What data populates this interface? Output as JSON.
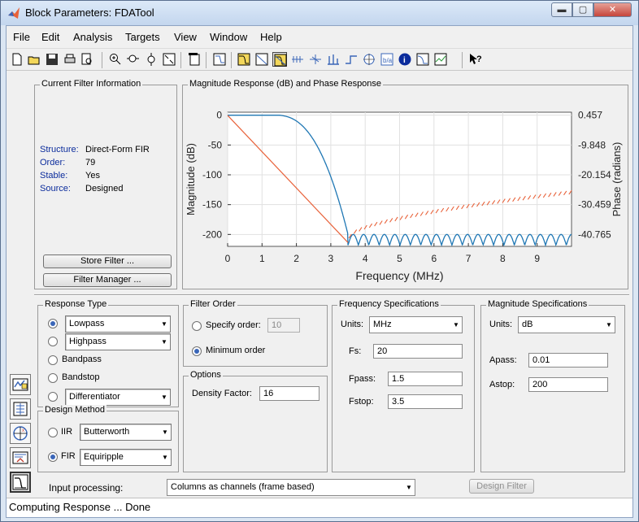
{
  "window": {
    "title": "Block Parameters: FDATool",
    "controls": {
      "minimize": "▬",
      "maximize": "▢",
      "close": "✕"
    },
    "accent": "#3a66b8"
  },
  "menu": [
    "File",
    "Edit",
    "Analysis",
    "Targets",
    "View",
    "Window",
    "Help"
  ],
  "toolbar": {
    "icons": [
      "new-icon",
      "open-icon",
      "save-icon",
      "print-icon",
      "print-preview-icon",
      "zoom-in-icon",
      "zoom-x-icon",
      "zoom-y-icon",
      "full-view-icon",
      "new-window-icon",
      "filter-specs-icon",
      "magnitude-icon",
      "phase-icon",
      "mag-phase-icon",
      "group-delay-icon",
      "phase-delay-icon",
      "impulse-icon",
      "step-icon",
      "pole-zero-icon",
      "coefficients-icon",
      "info-icon",
      "round-off-icon",
      "magnitude-estimate-icon",
      "whats-this-icon"
    ],
    "active": "mag-phase-icon"
  },
  "current_filter": {
    "title": "Current Filter Information",
    "rows": [
      {
        "key": "Structure:",
        "value": "Direct-Form FIR"
      },
      {
        "key": "Order:",
        "value": "79"
      },
      {
        "key": "Stable:",
        "value": "Yes"
      },
      {
        "key": "Source:",
        "value": "Designed"
      }
    ],
    "store_button": "Store Filter ...",
    "manager_button": "Filter Manager ..."
  },
  "plot_panel": {
    "title": "Magnitude Response (dB) and Phase Response"
  },
  "chart_data": {
    "type": "line",
    "title": "",
    "xlabel": "Frequency (MHz)",
    "ylabel": "Magnitude (dB)",
    "y2label": "Phase (radians)",
    "xlim": [
      0,
      10
    ],
    "ylim": [
      -220,
      5
    ],
    "xticks": [
      0,
      1,
      2,
      3,
      4,
      5,
      6,
      7,
      8,
      9
    ],
    "yticks": [
      0,
      -50,
      -100,
      -150,
      -200
    ],
    "y2ticks": [
      "0.457",
      "-9.848",
      "-20.154",
      "-30.459",
      "-40.765"
    ],
    "grid": true,
    "series": [
      {
        "role": "magnitude",
        "color": "#1f77b4",
        "passband_edge": 1.5,
        "stopband_edge": 3.5,
        "stopband_level": -200,
        "ripple_floor": -218
      },
      {
        "role": "phase",
        "color": "#e8623a",
        "y2lim": [
          -42,
          1.5
        ],
        "start": 0.457,
        "end_linear": -40.765,
        "linear_until": 3.5,
        "wrap_start": -38.8,
        "wrap_end": -24.6
      }
    ]
  },
  "response_type": {
    "title": "Response Type",
    "options": [
      {
        "label": "Lowpass",
        "selected": true,
        "dropdown": true
      },
      {
        "label": "Highpass",
        "selected": false,
        "dropdown": true
      },
      {
        "label": "Bandpass",
        "selected": false,
        "dropdown": false
      },
      {
        "label": "Bandstop",
        "selected": false,
        "dropdown": false
      },
      {
        "label": "Differentiator",
        "selected": false,
        "dropdown": true
      }
    ]
  },
  "design_method": {
    "title": "Design Method",
    "iir": {
      "label": "IIR",
      "value": "Butterworth",
      "selected": false
    },
    "fir": {
      "label": "FIR",
      "value": "Equiripple",
      "selected": true
    }
  },
  "filter_order": {
    "title": "Filter Order",
    "specify_label": "Specify order:",
    "specify_value": "10",
    "minimum_label": "Minimum order",
    "selected": "minimum"
  },
  "options": {
    "title": "Options",
    "density_label": "Density Factor:",
    "density_value": "16"
  },
  "freq_specs": {
    "title": "Frequency Specifications",
    "units_label": "Units:",
    "units_value": "MHz",
    "fs_label": "Fs:",
    "fs_value": "20",
    "fpass_label": "Fpass:",
    "fpass_value": "1.5",
    "fstop_label": "Fstop:",
    "fstop_value": "3.5"
  },
  "mag_specs": {
    "title": "Magnitude Specifications",
    "units_label": "Units:",
    "units_value": "dB",
    "apass_label": "Apass:",
    "apass_value": "0.01",
    "astop_label": "Astop:",
    "astop_value": "200"
  },
  "input_processing": {
    "label": "Input processing:",
    "value": "Columns as channels (frame based)"
  },
  "design_button": "Design Filter",
  "status": "Computing Response ... Done"
}
